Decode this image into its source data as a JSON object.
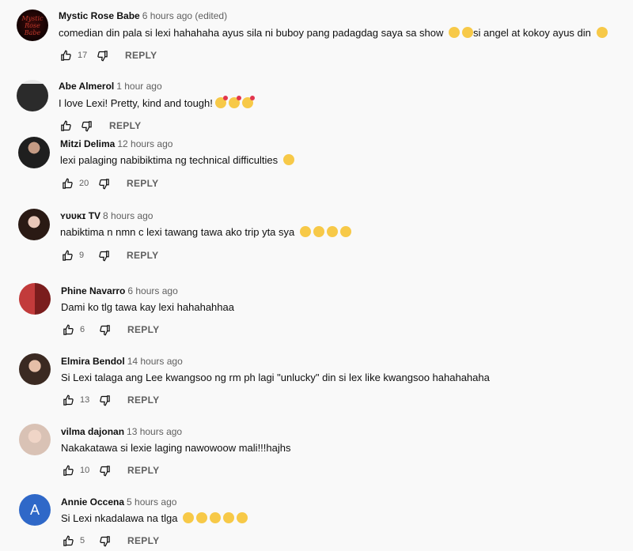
{
  "ui": {
    "reply_label": "REPLY"
  },
  "comments": [
    {
      "author": "Mystic Rose Babe",
      "time": "6 hours ago (edited)",
      "text_parts": [
        "comedian din pala si lexi hahahaha ayus sila ni buboy pang padagdag saya sa show ",
        "si angel at kokoy ayus din "
      ],
      "likes": "17",
      "avatar_text": "Mystic Rose Babe"
    },
    {
      "author": "Abe Almerol",
      "time": "1 hour ago",
      "text_parts": [
        "I love Lexi! Pretty, kind and tough!"
      ],
      "likes": ""
    },
    {
      "author": "Mitzi Delima",
      "time": "12 hours ago",
      "text_parts": [
        "lexi palaging nabibiktima ng technical difficulties "
      ],
      "likes": "20"
    },
    {
      "author": "ʏᴜᴜᴋɪ TV",
      "time": "8 hours ago",
      "text_parts": [
        "nabiktima n nmn c lexi tawang tawa ako trip yta sya "
      ],
      "likes": "9"
    },
    {
      "author": "Phine Navarro",
      "time": "6 hours ago",
      "text_parts": [
        "Dami ko tlg tawa kay lexi hahahahhaa"
      ],
      "likes": "6"
    },
    {
      "author": "Elmira Bendol",
      "time": "14 hours ago",
      "text_parts": [
        "Si Lexi talaga ang Lee kwangsoo ng rm ph lagi \"unlucky\" din si lex like kwangsoo hahahahaha"
      ],
      "likes": "13"
    },
    {
      "author": "vilma dajonan",
      "time": "13 hours ago",
      "text_parts": [
        "Nakakatawa si lexie laging nawowoow mali!!!hajhs"
      ],
      "likes": "10"
    },
    {
      "author": "Annie Occena",
      "time": "5 hours ago",
      "text_parts": [
        "Si Lexi nkadalawa na tlga "
      ],
      "likes": "5",
      "avatar_letter": "A"
    }
  ]
}
